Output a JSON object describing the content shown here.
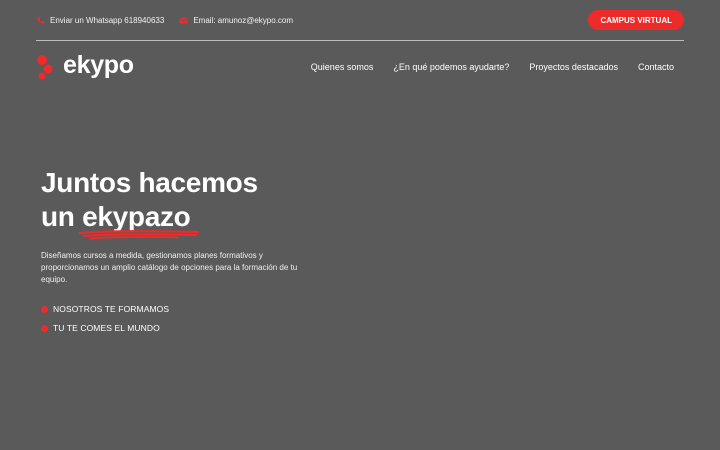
{
  "topbar": {
    "whatsapp_label": "Enviar un Whatsapp 618940633",
    "email_label": "Email: amunoz@ekypo.com",
    "campus_button": "CAMPUS VIRTUAL"
  },
  "header": {
    "logo_text": "ekypo",
    "nav": [
      {
        "label": "Quienes somos"
      },
      {
        "label": "¿En qué podemos ayudarte?"
      },
      {
        "label": "Proyectos destacados"
      },
      {
        "label": "Contacto"
      }
    ]
  },
  "hero": {
    "title_line1": "Juntos hacemos",
    "title_line2_prefix": "un ",
    "title_highlight": "ekypazo",
    "description": "Diseñamos cursos a medida, gestionamos planes formativos y proporcionamos un amplio catálogo de opciones para la formación de tu equipo.",
    "bullets": [
      {
        "label": "NOSOTROS TE FORMAMOS"
      },
      {
        "label": "TU TE COMES EL MUNDO"
      }
    ]
  },
  "colors": {
    "background": "#5a5a5a",
    "accent": "#ee2b2b"
  },
  "icons": {
    "whatsapp": "whatsapp-icon",
    "email": "envelope-icon",
    "logo": "ekypo-dots-logo"
  }
}
